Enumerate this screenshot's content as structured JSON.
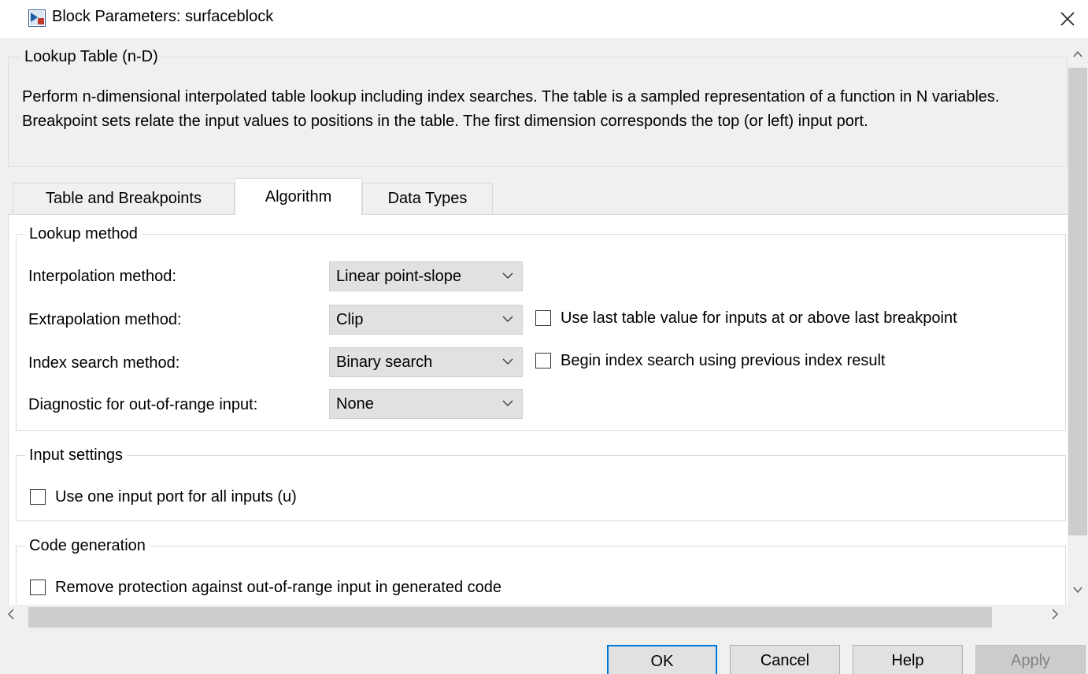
{
  "window": {
    "title": "Block Parameters: surfaceblock",
    "icon": "simulink-block-icon",
    "close_icon": "close-icon"
  },
  "description": {
    "block_type": "Lookup Table (n-D)",
    "text": "Perform n-dimensional interpolated table lookup including index searches. The table is a sampled representation of a function in N variables. Breakpoint sets relate the input values to positions in the table. The first dimension corresponds the top (or left) input port."
  },
  "tabs": [
    {
      "label": "Table and Breakpoints",
      "selected": false
    },
    {
      "label": "Algorithm",
      "selected": true
    },
    {
      "label": "Data Types",
      "selected": false
    }
  ],
  "lookup_method": {
    "legend": "Lookup method",
    "interpolation": {
      "label": "Interpolation method:",
      "value": "Linear point-slope"
    },
    "extrapolation": {
      "label": "Extrapolation method:",
      "value": "Clip",
      "checkbox_label": "Use last table value for inputs at or above last breakpoint",
      "checked": false
    },
    "index_search": {
      "label": "Index search method:",
      "value": "Binary search",
      "checkbox_label": "Begin index search using previous index result",
      "checked": false
    },
    "diagnostic": {
      "label": "Diagnostic for out-of-range input:",
      "value": "None"
    }
  },
  "input_settings": {
    "legend": "Input settings",
    "checkbox_label": "Use one input port for all inputs (u)",
    "checked": false
  },
  "code_generation": {
    "legend": "Code generation",
    "checkbox_label": "Remove protection against out-of-range input in generated code",
    "checked": false
  },
  "buttons": {
    "ok": "OK",
    "cancel": "Cancel",
    "help": "Help",
    "apply": "Apply"
  },
  "scrollbars": {
    "up_icon": "chevron-up-icon",
    "down_icon": "chevron-down-icon",
    "left_icon": "chevron-left-icon",
    "right_icon": "chevron-right-icon"
  },
  "colors": {
    "default_button_border": "#0078d7",
    "disabled_text": "#838383"
  }
}
